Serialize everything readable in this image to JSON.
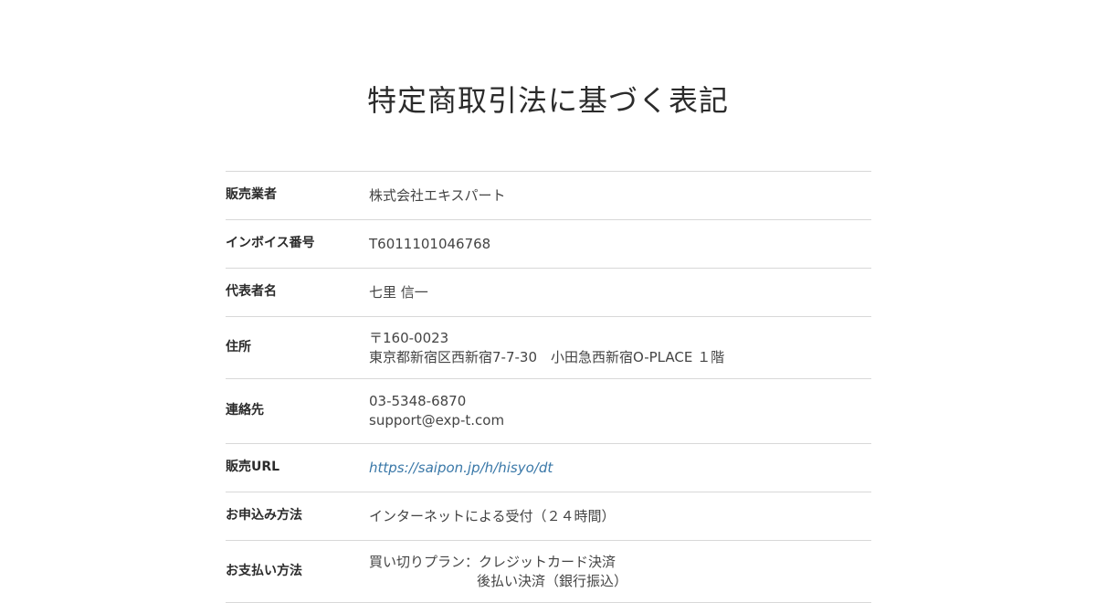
{
  "page": {
    "title": "特定商取引法に基づく表記"
  },
  "rows": [
    {
      "label": "販売業者",
      "lines": [
        "株式会社エキスパート"
      ]
    },
    {
      "label": "インボイス番号",
      "lines": [
        "T6011101046768"
      ]
    },
    {
      "label": "代表者名",
      "lines": [
        "七里 信一"
      ]
    },
    {
      "label": "住所",
      "lines": [
        "〒160-0023",
        "東京都新宿区西新宿7-7-30　小田急西新宿O-PLACE １階"
      ]
    },
    {
      "label": "連絡先",
      "lines": [
        "03-5348-6870",
        "support@exp-t.com"
      ]
    },
    {
      "label": "販売URL",
      "lines": [
        "https://saipon.jp/h/hisyo/dt"
      ]
    },
    {
      "label": "お申込み方法",
      "lines": [
        "インターネットによる受付（２４時間）"
      ]
    },
    {
      "label": "お支払い方法",
      "lines": [
        "買い切りプラン：クレジットカード決済",
        "後払い決済（銀行振込）"
      ]
    }
  ],
  "colors": {
    "link": "#3a78a8",
    "divider": "#d8d8d8",
    "text": "#444444"
  }
}
